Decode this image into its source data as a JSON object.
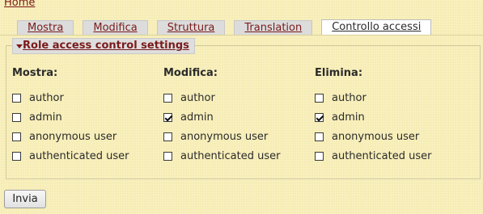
{
  "breadcrumb": {
    "home": "Home"
  },
  "tabs": [
    {
      "label": "Mostra",
      "active": false
    },
    {
      "label": "Modifica",
      "active": false
    },
    {
      "label": "Struttura",
      "active": false
    },
    {
      "label": "Translation",
      "active": false
    },
    {
      "label": "Controllo accessi",
      "active": true
    }
  ],
  "section": {
    "legend": "Role access control settings"
  },
  "columns": [
    {
      "title": "Mostra:",
      "items": [
        {
          "label": "author",
          "checked": false
        },
        {
          "label": "admin",
          "checked": false
        },
        {
          "label": "anonymous user",
          "checked": false
        },
        {
          "label": "authenticated user",
          "checked": false
        }
      ]
    },
    {
      "title": "Modifica:",
      "items": [
        {
          "label": "author",
          "checked": false
        },
        {
          "label": "admin",
          "checked": true
        },
        {
          "label": "anonymous user",
          "checked": false
        },
        {
          "label": "authenticated user",
          "checked": false
        }
      ]
    },
    {
      "title": "Elimina:",
      "items": [
        {
          "label": "author",
          "checked": false
        },
        {
          "label": "admin",
          "checked": true
        },
        {
          "label": "anonymous user",
          "checked": false
        },
        {
          "label": "authenticated user",
          "checked": false
        }
      ]
    }
  ],
  "submit": {
    "label": "Invia"
  }
}
